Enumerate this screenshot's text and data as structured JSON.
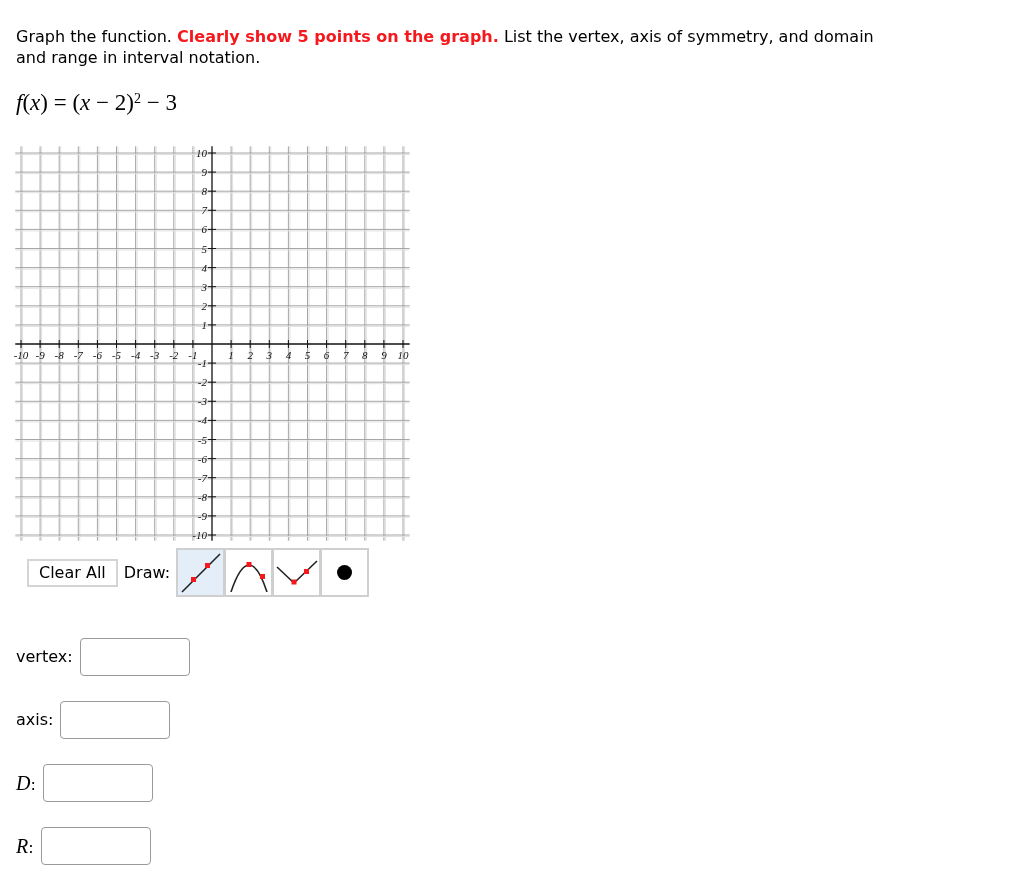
{
  "prompt": {
    "text": "Graph the function. **Clearly show 5 points on the graph.** List the vertex, axis of symmetry, and domain and range in interval notation."
  },
  "function": "*f*(*x*) = (*x* − 2)$^{2}$ − 3",
  "graph": {
    "chart_data": {
      "type": "scatter",
      "grid": true,
      "xlim": [
        -10,
        10
      ],
      "ylim": [
        -10,
        10
      ],
      "xticks": [
        -10,
        -9,
        -8,
        -7,
        -6,
        -5,
        -4,
        -3,
        -2,
        -1,
        1,
        2,
        3,
        4,
        5,
        6,
        7,
        8,
        9,
        10
      ],
      "yticks": [
        10,
        9,
        8,
        7,
        6,
        5,
        4,
        3,
        2,
        1,
        -1,
        -2,
        -3,
        -4,
        -5,
        -6,
        -7,
        -8,
        -9,
        -10
      ]
    }
  },
  "toolbar": {
    "clear_button": "Clear All",
    "draw_label": "Draw:",
    "tools": [
      {
        "kind": "line",
        "selected": true
      },
      {
        "kind": "parabola",
        "selected": false
      },
      {
        "kind": "vshape",
        "selected": false
      },
      {
        "kind": "point",
        "selected": false
      }
    ]
  },
  "answers": [
    {
      "label": "vertex:"
    },
    {
      "label": "axis:"
    },
    {
      "label": "*D*:"
    },
    {
      "label": "*R*:"
    }
  ]
}
